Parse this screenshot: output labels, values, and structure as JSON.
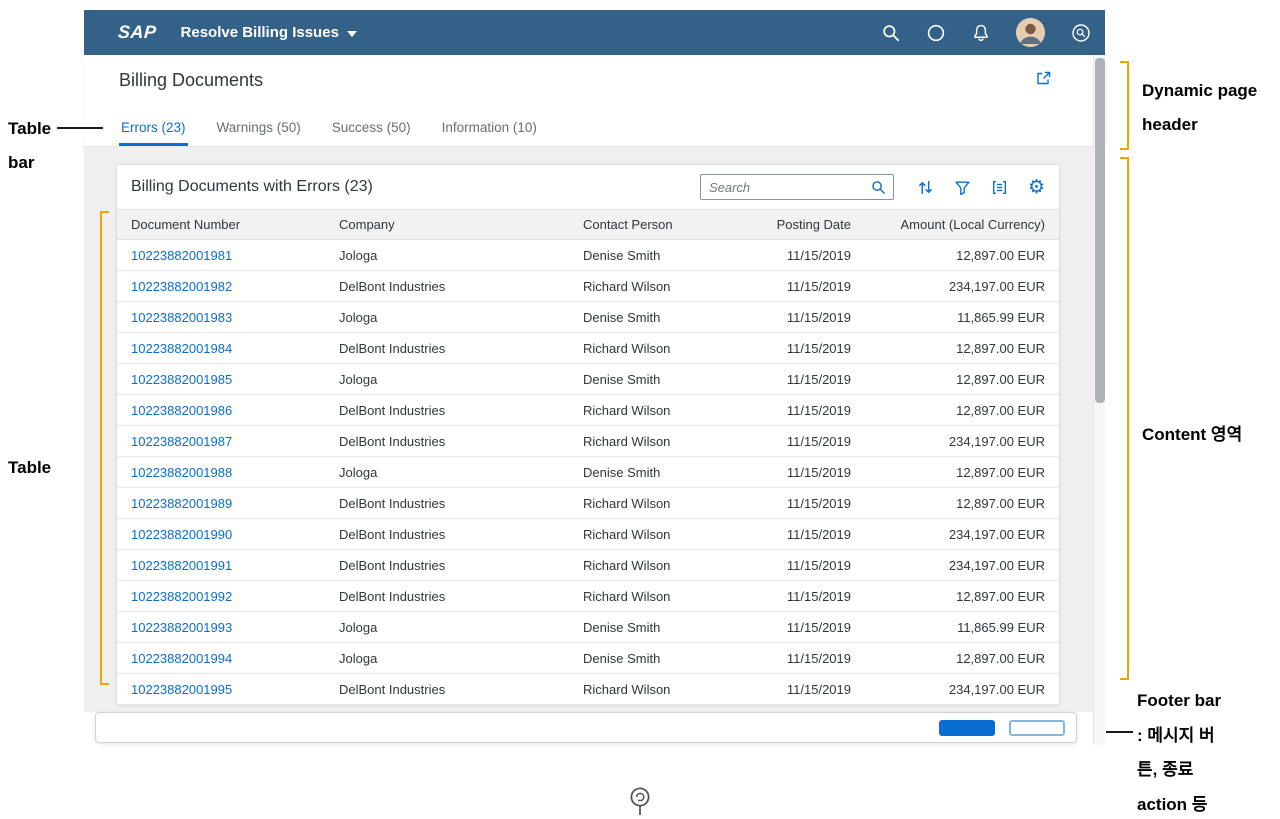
{
  "colors": {
    "shell": "#346187",
    "accent": "#0a6ed1",
    "annotation": "#f0a500",
    "content_bg": "#efefef"
  },
  "shell": {
    "logo": "SAP",
    "app_title": "Resolve Billing Issues"
  },
  "page": {
    "title": "Billing Documents",
    "tabs": [
      {
        "label": "Errors (23)",
        "selected": true
      },
      {
        "label": "Warnings (50)",
        "selected": false
      },
      {
        "label": "Success (50)",
        "selected": false
      },
      {
        "label": "Information (10)",
        "selected": false
      }
    ]
  },
  "table": {
    "title": "Billing Documents with Errors (23)",
    "search_placeholder": "Search",
    "columns": [
      "Document Number",
      "Company",
      "Contact Person",
      "Posting Date",
      "Amount (Local Currency)"
    ],
    "rows": [
      [
        "10223882001981",
        "Jologa",
        "Denise Smith",
        "11/15/2019",
        "12,897.00 EUR"
      ],
      [
        "10223882001982",
        "DelBont Industries",
        "Richard Wilson",
        "11/15/2019",
        "234,197.00 EUR"
      ],
      [
        "10223882001983",
        "Jologa",
        "Denise Smith",
        "11/15/2019",
        "11,865.99 EUR"
      ],
      [
        "10223882001984",
        "DelBont Industries",
        "Richard Wilson",
        "11/15/2019",
        "12,897.00 EUR"
      ],
      [
        "10223882001985",
        "Jologa",
        "Denise Smith",
        "11/15/2019",
        "12,897.00 EUR"
      ],
      [
        "10223882001986",
        "DelBont Industries",
        "Richard Wilson",
        "11/15/2019",
        "12,897.00 EUR"
      ],
      [
        "10223882001987",
        "DelBont Industries",
        "Richard Wilson",
        "11/15/2019",
        "234,197.00 EUR"
      ],
      [
        "10223882001988",
        "Jologa",
        "Denise Smith",
        "11/15/2019",
        "12,897.00 EUR"
      ],
      [
        "10223882001989",
        "DelBont Industries",
        "Richard Wilson",
        "11/15/2019",
        "12,897.00 EUR"
      ],
      [
        "10223882001990",
        "DelBont Industries",
        "Richard Wilson",
        "11/15/2019",
        "234,197.00 EUR"
      ],
      [
        "10223882001991",
        "DelBont Industries",
        "Richard Wilson",
        "11/15/2019",
        "234,197.00 EUR"
      ],
      [
        "10223882001992",
        "DelBont Industries",
        "Richard Wilson",
        "11/15/2019",
        "12,897.00 EUR"
      ],
      [
        "10223882001993",
        "Jologa",
        "Denise Smith",
        "11/15/2019",
        "11,865.99 EUR"
      ],
      [
        "10223882001994",
        "Jologa",
        "Denise Smith",
        "11/15/2019",
        "12,897.00 EUR"
      ],
      [
        "10223882001995",
        "DelBont Industries",
        "Richard Wilson",
        "11/15/2019",
        "234,197.00 EUR"
      ]
    ]
  },
  "annotations": {
    "table_bar": [
      "Table",
      "bar"
    ],
    "table": "Table",
    "dynamic_header": [
      "Dynamic page",
      "header"
    ],
    "content": "Content 영역",
    "footer": [
      "Footer bar",
      ": 메시지 버",
      "튼, 종료",
      "action 등"
    ]
  }
}
